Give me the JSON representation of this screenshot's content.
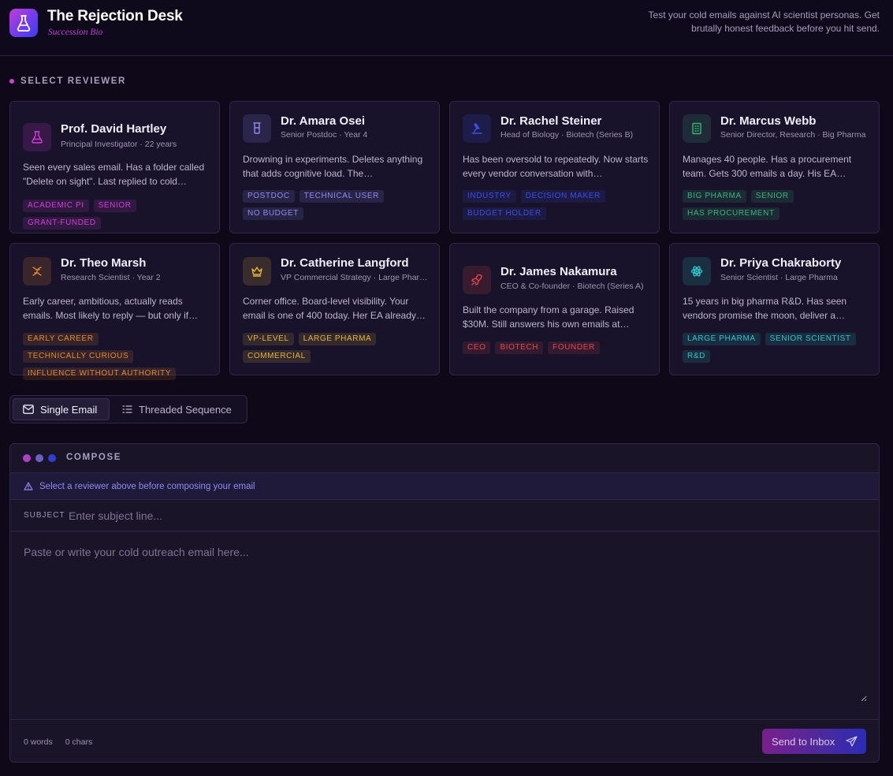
{
  "header": {
    "title": "The Rejection Desk",
    "subtitle": "Succession Bio",
    "tagline": "Test your cold emails against AI scientist personas. Get brutally honest feedback before you hit send."
  },
  "reviewers": {
    "section_label": "SELECT REVIEWER",
    "cards": [
      {
        "name": "Prof. David Hartley",
        "role": "Principal Investigator · 22 years",
        "desc": "Seen every sales email. Has a folder called \"Delete on sight\". Last replied to cold…",
        "icon": "flask-icon",
        "color": "#d13fd8",
        "tags": [
          "ACADEMIC PI",
          "SENIOR",
          "GRANT-FUNDED"
        ]
      },
      {
        "name": "Dr. Amara Osei",
        "role": "Senior Postdoc · Year 4",
        "desc": "Drowning in experiments. Deletes anything that adds cognitive load. The…",
        "icon": "beaker-icon",
        "color": "#8f8bf0",
        "tags": [
          "POSTDOC",
          "TECHNICAL USER",
          "NO BUDGET"
        ]
      },
      {
        "name": "Dr. Rachel Steiner",
        "role": "Head of Biology · Biotech (Series B)",
        "desc": "Has been oversold to repeatedly. Now starts every vendor conversation with…",
        "icon": "microscope-icon",
        "color": "#3d4ee6",
        "tags": [
          "INDUSTRY",
          "DECISION MAKER",
          "BUDGET HOLDER"
        ]
      },
      {
        "name": "Dr. Marcus Webb",
        "role": "Senior Director, Research · Big Pharma",
        "desc": "Manages 40 people. Has a procurement team. Gets 300 emails a day. His EA…",
        "icon": "building-icon",
        "color": "#3ab57a",
        "tags": [
          "BIG PHARMA",
          "SENIOR",
          "HAS PROCUREMENT"
        ]
      },
      {
        "name": "Dr. Theo Marsh",
        "role": "Research Scientist · Year 2",
        "desc": "Early career, ambitious, actually reads emails. Most likely to reply — but only if…",
        "icon": "dna-icon",
        "color": "#e58a2c",
        "tags": [
          "EARLY CAREER",
          "TECHNICALLY CURIOUS",
          "INFLUENCE WITHOUT AUTHORITY"
        ]
      },
      {
        "name": "Dr. Catherine Langford",
        "role": "VP Commercial Strategy · Large Pharma",
        "desc": "Corner office. Board-level visibility. Your email is one of 400 today. Her EA already…",
        "icon": "crown-icon",
        "color": "#e5b43a",
        "tags": [
          "VP-LEVEL",
          "LARGE PHARMA",
          "COMMERCIAL"
        ]
      },
      {
        "name": "Dr. James Nakamura",
        "role": "CEO & Co-founder · Biotech (Series A)",
        "desc": "Built the company from a garage. Raised $30M. Still answers his own emails at…",
        "icon": "rocket-icon",
        "color": "#e5484d",
        "tags": [
          "CEO",
          "BIOTECH",
          "FOUNDER"
        ]
      },
      {
        "name": "Dr. Priya Chakraborty",
        "role": "Senior Scientist · Large Pharma",
        "desc": "15 years in big pharma R&D. Has seen vendors promise the moon, deliver a…",
        "icon": "atom-icon",
        "color": "#2ec7c7",
        "tags": [
          "LARGE PHARMA",
          "SENIOR SCIENTIST",
          "R&D"
        ]
      }
    ]
  },
  "modes": {
    "single": "Single Email",
    "threaded": "Threaded Sequence"
  },
  "compose": {
    "title": "COMPOSE",
    "warning": "Select a reviewer above before composing your email",
    "subject_label": "SUBJECT",
    "subject_placeholder": "Enter subject line...",
    "body_placeholder": "Paste or write your cold outreach email here...",
    "words": "0 words",
    "chars": "0 chars",
    "send_label": "Send to Inbox"
  },
  "colors": {
    "accent_magenta": "#d13fd8",
    "accent_violet": "#6b3cf0",
    "accent_blue": "#3a3ef0",
    "background": "#0e0818",
    "panel": "#1a1429"
  }
}
